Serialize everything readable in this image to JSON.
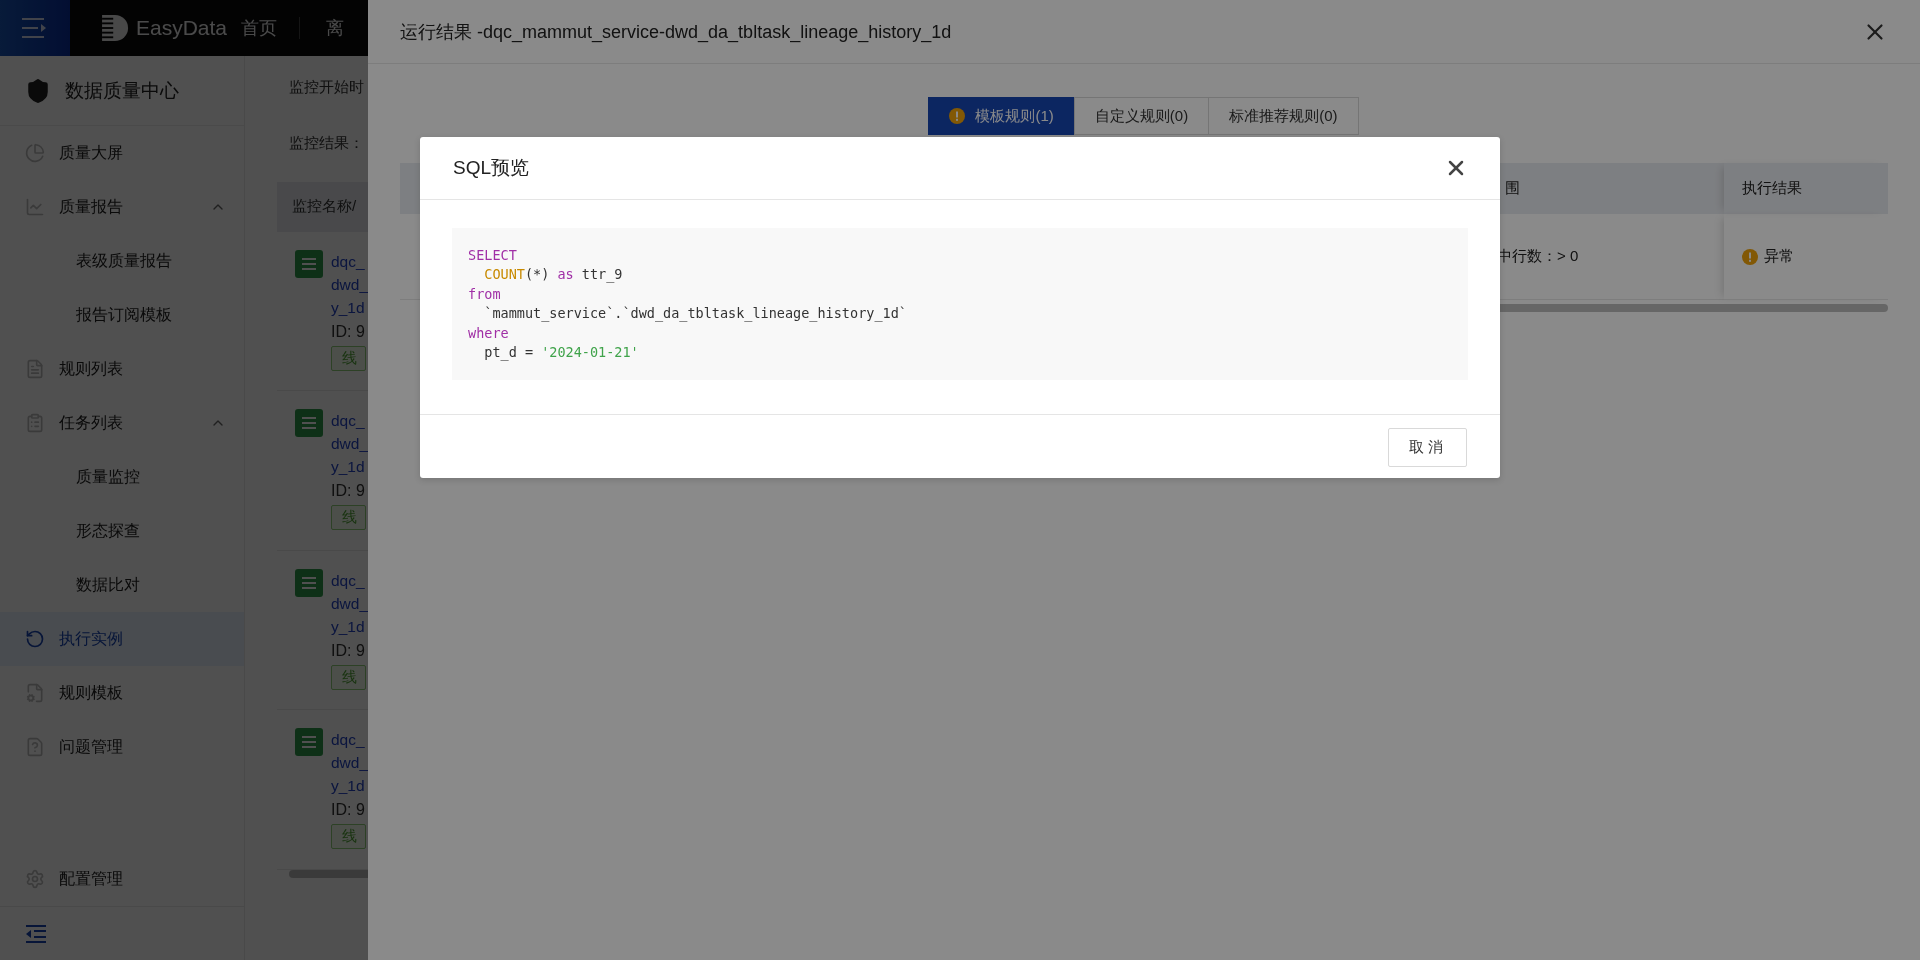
{
  "header": {
    "logo": "EasyData",
    "nav": [
      {
        "label": "首页"
      },
      {
        "label": "离"
      }
    ]
  },
  "sidebar": {
    "title": "数据质量中心",
    "items": [
      {
        "label": "质量大屏",
        "selected": false
      },
      {
        "label": "质量报告",
        "selected": false,
        "expanded": true,
        "children": [
          {
            "label": "表级质量报告",
            "selected": false
          },
          {
            "label": "报告订阅模板",
            "selected": false
          }
        ]
      },
      {
        "label": "规则列表",
        "selected": false
      },
      {
        "label": "任务列表",
        "selected": false,
        "expanded": true,
        "children": [
          {
            "label": "质量监控",
            "selected": false
          },
          {
            "label": "形态探查",
            "selected": false
          },
          {
            "label": "数据比对",
            "selected": false
          }
        ]
      },
      {
        "label": "执行实例",
        "selected": true
      },
      {
        "label": "规则模板",
        "selected": false
      },
      {
        "label": "问题管理",
        "selected": false
      }
    ],
    "footer_item": {
      "label": "配置管理"
    }
  },
  "page": {
    "filters": [
      {
        "label": "监控开始时"
      },
      {
        "label": "监控结果："
      }
    ],
    "list_header": "监控名称/",
    "tasks": [
      {
        "name_lines": [
          "dqc_",
          "dwd_",
          "y_1d"
        ],
        "id": "ID: 9",
        "tag": "线"
      },
      {
        "name_lines": [
          "dqc_",
          "dwd_",
          "y_1d"
        ],
        "id": "ID: 9",
        "tag": "线"
      },
      {
        "name_lines": [
          "dqc_",
          "dwd_",
          "y_1d"
        ],
        "id": "ID: 9",
        "tag": "线"
      },
      {
        "name_lines": [
          "dqc_",
          "dwd_",
          "y_1d"
        ],
        "id": "ID: 9",
        "tag": "线"
      }
    ]
  },
  "drawer": {
    "title": "运行结果 -dqc_mammut_service-dwd_da_tbltask_lineage_history_1d",
    "tabs": [
      {
        "label": "模板规则(1)",
        "selected": true,
        "warning": true
      },
      {
        "label": "自定义规则(0)",
        "selected": false,
        "warning": false
      },
      {
        "label": "标准推荐规则(0)",
        "selected": false,
        "warning": false
      }
    ],
    "table": {
      "columns": [
        "围",
        "执行结果"
      ],
      "rows": [
        {
          "cells": [
            "中行数：> 0"
          ],
          "result": "异常",
          "kind": "abnormal"
        }
      ]
    }
  },
  "modal": {
    "title": "SQL预览",
    "code": [
      {
        "tokens": [
          {
            "text": "SELECT",
            "kind": "keyword"
          }
        ]
      },
      {
        "tokens": [
          {
            "text": "  COUNT",
            "kind": "function"
          },
          {
            "text": "(*) ",
            "kind": "plain"
          },
          {
            "text": "as",
            "kind": "keyword"
          },
          {
            "text": " ttr_9",
            "kind": "plain"
          }
        ]
      },
      {
        "tokens": [
          {
            "text": "from",
            "kind": "keyword"
          }
        ]
      },
      {
        "tokens": [
          {
            "text": "  `mammut_service`.`dwd_da_tbltask_lineage_history_1d`",
            "kind": "plain"
          }
        ]
      },
      {
        "tokens": [
          {
            "text": "where",
            "kind": "keyword"
          }
        ]
      },
      {
        "tokens": [
          {
            "text": "  pt_d = ",
            "kind": "plain"
          },
          {
            "text": "'2024-01-21'",
            "kind": "string"
          }
        ]
      }
    ],
    "buttons": [
      {
        "label": "取消"
      }
    ]
  }
}
